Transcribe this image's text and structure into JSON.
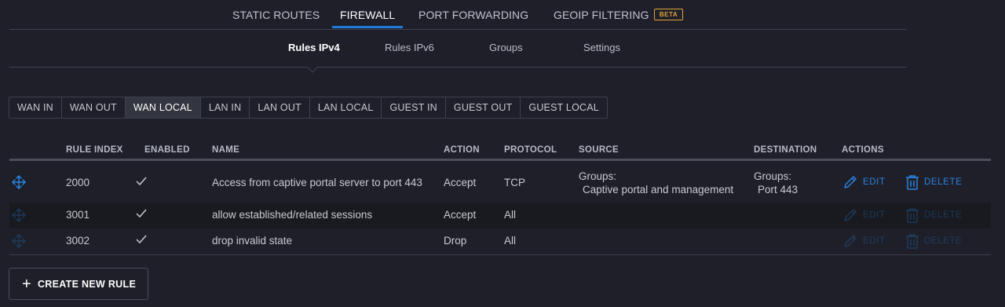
{
  "top_nav": {
    "tabs": [
      {
        "label": "STATIC ROUTES"
      },
      {
        "label": "FIREWALL"
      },
      {
        "label": "PORT FORWARDING"
      },
      {
        "label": "GEOIP FILTERING"
      }
    ],
    "active": "FIREWALL",
    "beta_badge": "BETA"
  },
  "sub_nav": {
    "tabs": [
      {
        "label": "Rules IPv4"
      },
      {
        "label": "Rules IPv6"
      },
      {
        "label": "Groups"
      },
      {
        "label": "Settings"
      }
    ],
    "active": "Rules IPv4"
  },
  "direction_tabs": {
    "items": [
      "WAN IN",
      "WAN OUT",
      "WAN LOCAL",
      "LAN IN",
      "LAN OUT",
      "LAN LOCAL",
      "GUEST IN",
      "GUEST OUT",
      "GUEST LOCAL"
    ],
    "active": "WAN LOCAL"
  },
  "table": {
    "columns": [
      "RULE INDEX",
      "ENABLED",
      "NAME",
      "ACTION",
      "PROTOCOL",
      "SOURCE",
      "DESTINATION",
      "ACTIONS"
    ],
    "rows": [
      {
        "index": "2000",
        "enabled": true,
        "name": "Access from captive portal server to port 443",
        "action": "Accept",
        "protocol": "TCP",
        "source_label": "Groups:",
        "source_value": "Captive portal and management",
        "dest_label": "Groups:",
        "dest_value": "Port 443"
      },
      {
        "index": "3001",
        "enabled": true,
        "name": "allow established/related sessions",
        "action": "Accept",
        "protocol": "All",
        "source_label": "",
        "source_value": "",
        "dest_label": "",
        "dest_value": ""
      },
      {
        "index": "3002",
        "enabled": true,
        "name": "drop invalid state",
        "action": "Drop",
        "protocol": "All",
        "source_label": "",
        "source_value": "",
        "dest_label": "",
        "dest_value": ""
      }
    ],
    "edit_label": "EDIT",
    "delete_label": "DELETE"
  },
  "create_button": {
    "label": "CREATE NEW RULE"
  },
  "colors": {
    "background": "#1e1f29",
    "accent": "#1f7bd8",
    "beta": "#e0a43a",
    "link": "#2a83e0"
  }
}
